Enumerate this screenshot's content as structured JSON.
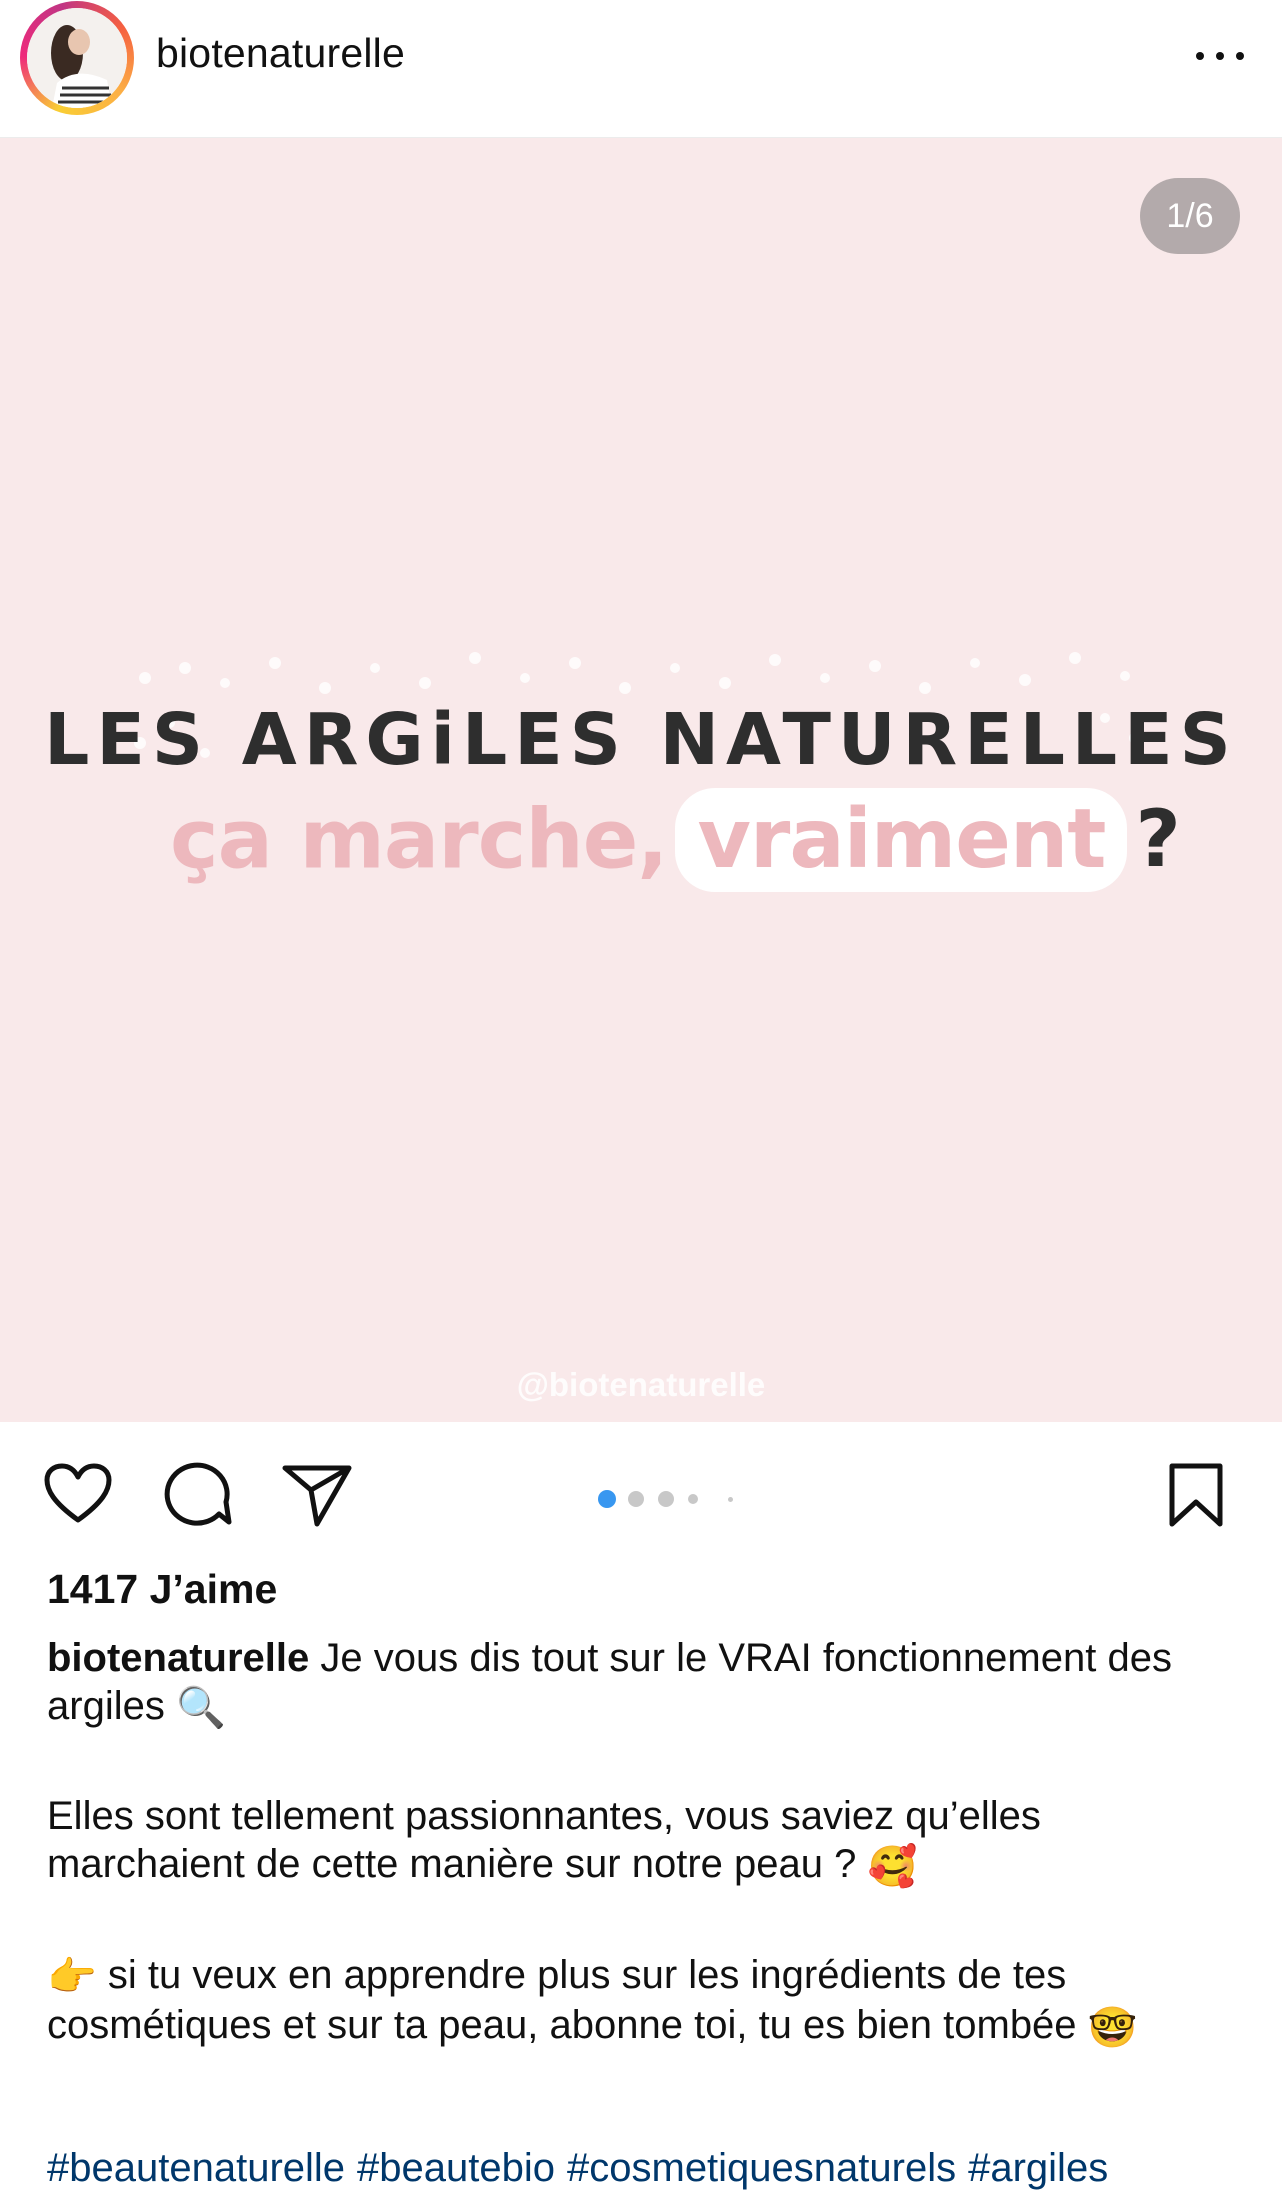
{
  "header": {
    "username": "biotenaturelle",
    "more_icon": "more-horizontal-icon"
  },
  "media": {
    "counter": "1/6",
    "headline": "LES ARGiLES NATURELLES",
    "subline_main": "ça marche,",
    "subline_highlight": "vraiment",
    "subline_question": "?",
    "watermark": "@biotenaturelle",
    "background": "#f9e9ea",
    "pink": "#edb8bd"
  },
  "actions": {
    "like_icon": "heart-icon",
    "comment_icon": "comment-icon",
    "share_icon": "paper-plane-icon",
    "save_icon": "bookmark-icon",
    "carousel_active_index": 1,
    "carousel_total_visible": 5,
    "active_dot_color": "#3897f0"
  },
  "likes": "1417 J’aime",
  "caption": {
    "username": "biotenaturelle",
    "line1": " Je vous dis tout sur le VRAI fonctionnement des argiles",
    "emoji1": "🔍",
    "para2": "Elles sont tellement passionnantes, vous saviez qu’elles marchaient de cette manière sur notre peau ?",
    "emoji2": "🥰",
    "emoji3": "👉",
    "para3": " si tu veux en apprendre plus sur les ingrédients de tes cosmétiques et sur ta peau, abonne toi, tu es bien tombée",
    "emoji4": "🤓"
  },
  "hashtags": [
    "#beautenaturelle",
    "#beautebio",
    "#cosmetiquesnaturels",
    "#argiles"
  ]
}
